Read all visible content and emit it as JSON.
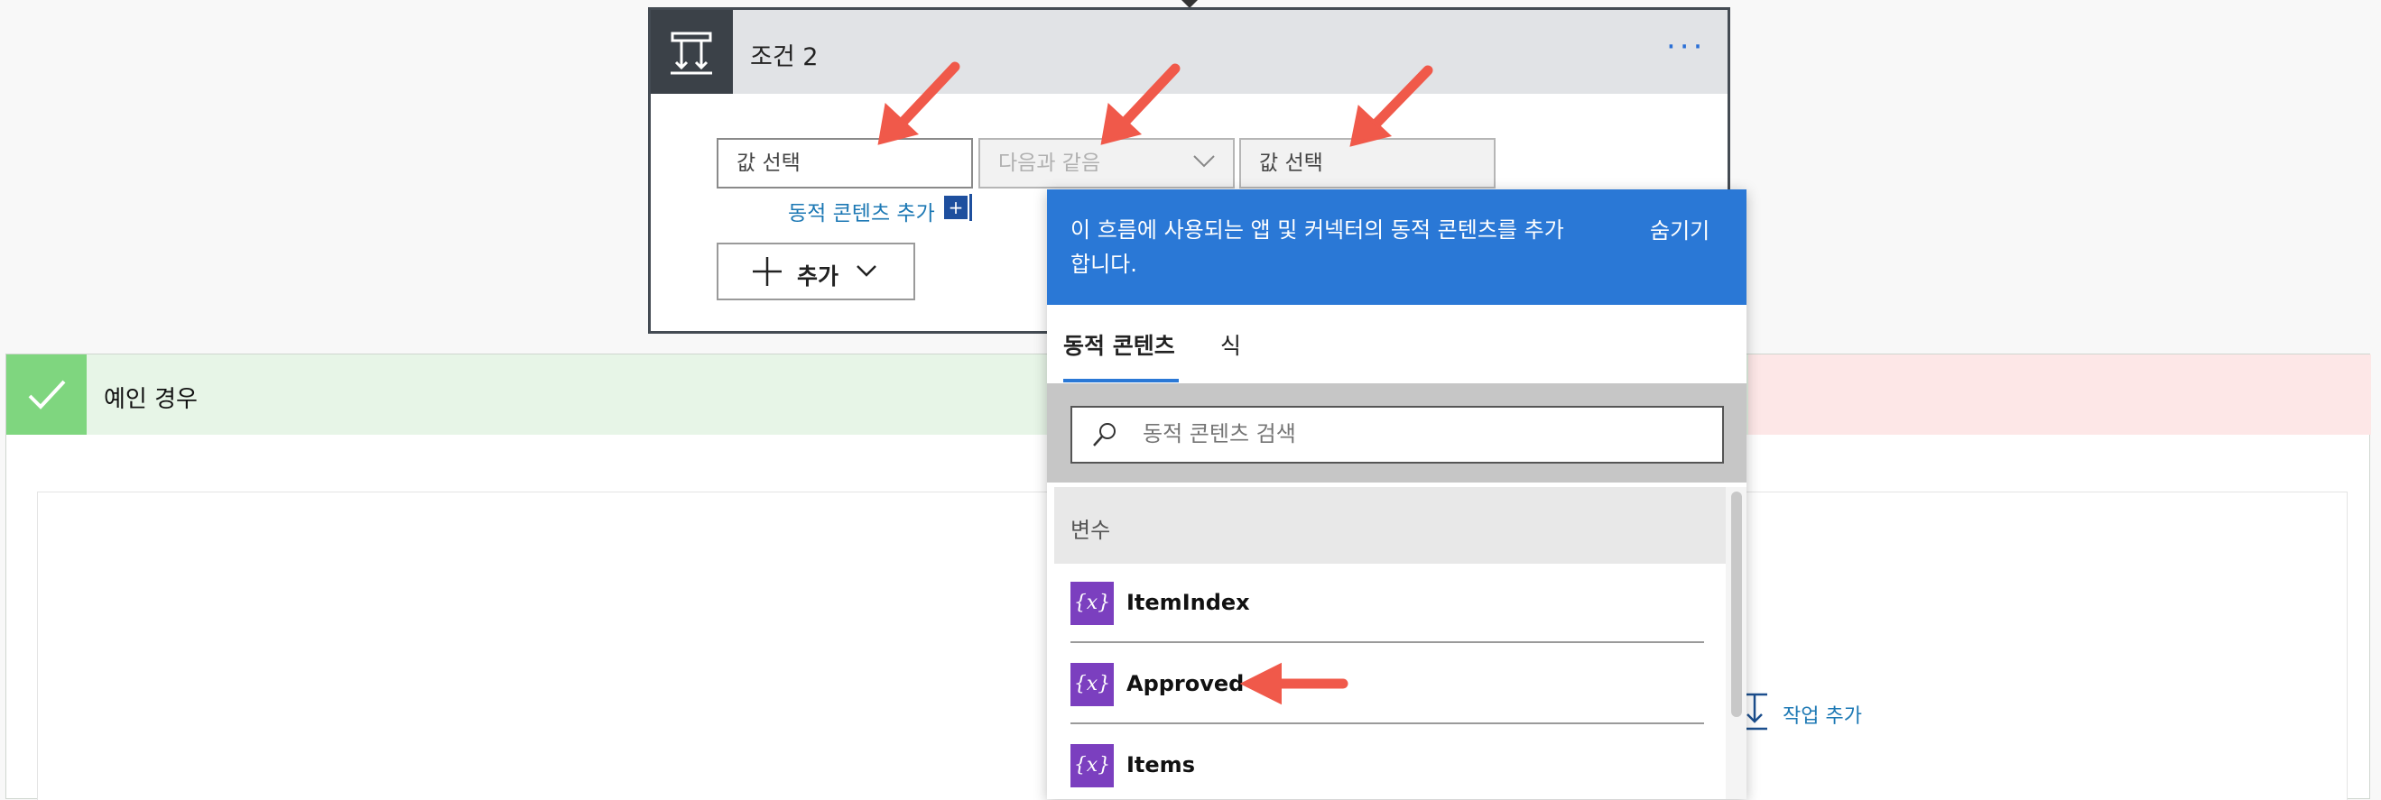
{
  "condition": {
    "title": "조건 2",
    "more": "···",
    "left_value": "값 선택",
    "operator": "다음과 같음",
    "right_value": "값 선택",
    "dynamic_link": "동적 콘텐츠 추가",
    "dynamic_plus": "+",
    "add_button": "추가"
  },
  "yes_branch": {
    "title": "예인 경우",
    "add_action": "작업 추가"
  },
  "popup": {
    "description": "이 흐름에 사용되는 앱 및 커넥터의 동적 콘텐츠를 추가합니다.",
    "hide": "숨기기",
    "tabs": [
      {
        "label": "동적 콘텐츠",
        "active": true
      },
      {
        "label": "식",
        "active": false
      }
    ],
    "search_placeholder": "동적 콘텐츠 검색",
    "section": "변수",
    "items": [
      {
        "label": "ItemIndex",
        "icon": "variable-icon",
        "icon_text": "{x}"
      },
      {
        "label": "Approved",
        "icon": "variable-icon",
        "icon_text": "{x}"
      },
      {
        "label": "Items",
        "icon": "variable-icon",
        "icon_text": "{x}"
      }
    ]
  },
  "colors": {
    "accent": "#2a78d6",
    "variable": "#7b3fbf",
    "yes": "#7fd67f",
    "annotation_arrow": "#f0594a"
  }
}
